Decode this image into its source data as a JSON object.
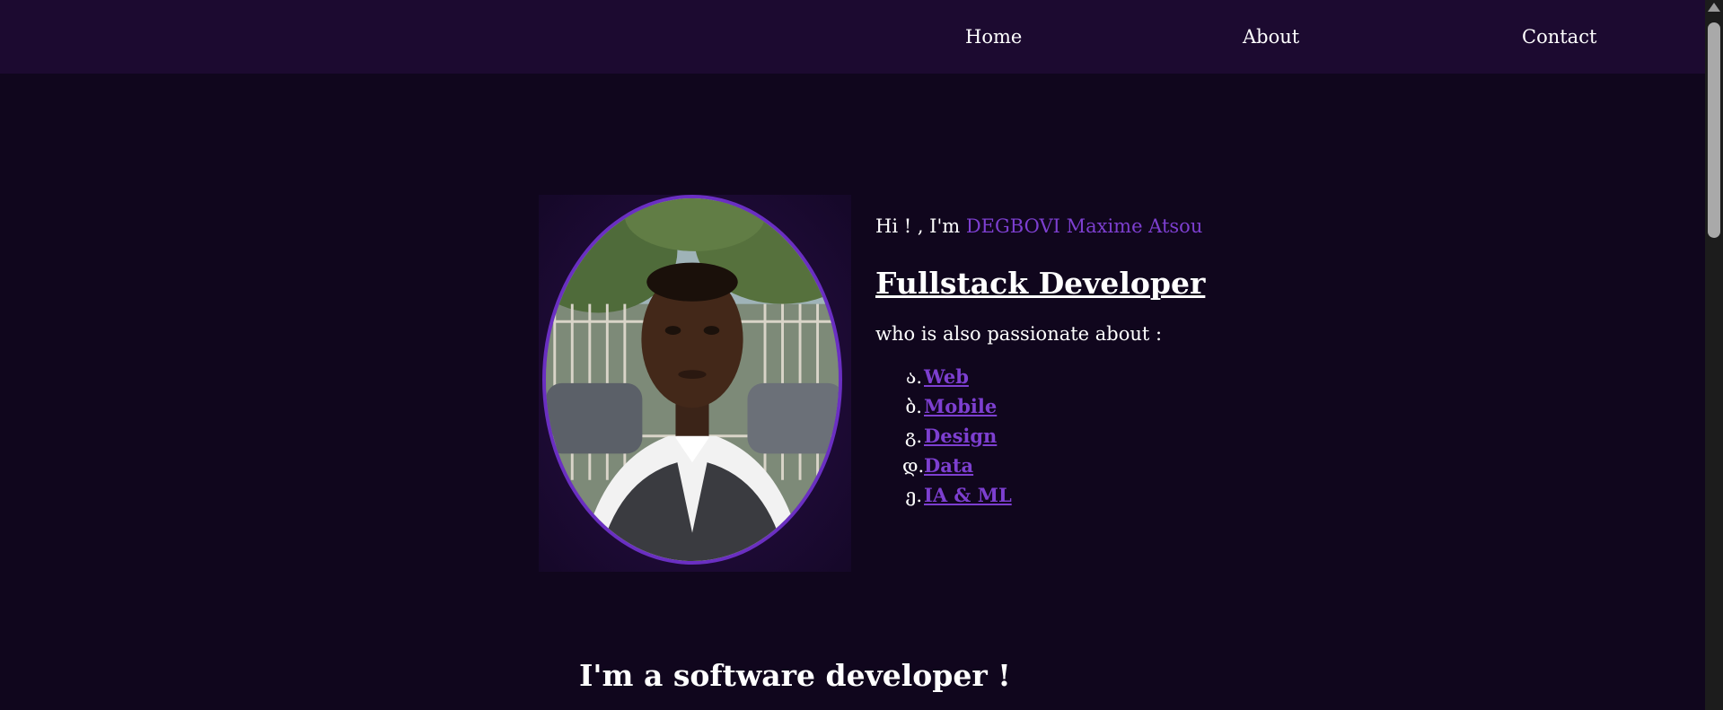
{
  "nav": {
    "home": "Home",
    "about": "About",
    "contact": "Contact"
  },
  "hero": {
    "greeting_prefix": "Hi ! , I'm ",
    "name": "DEGBOVI Maxime Atsou",
    "role": "Fullstack Developer",
    "passion": "who is also passionate about :",
    "skills": [
      {
        "marker": "ა.",
        "label": "Web"
      },
      {
        "marker": "ბ.",
        "label": "Mobile"
      },
      {
        "marker": "გ.",
        "label": "Design"
      },
      {
        "marker": "დ.",
        "label": "Data"
      },
      {
        "marker": "ე.",
        "label": "IA & ML"
      }
    ]
  },
  "section": {
    "subtitle": "I'm a software developer !"
  },
  "colors": {
    "background": "#10061d",
    "navbar": "#1c0a30",
    "accent": "#7d3fd0",
    "frame_border": "#6a2fc2"
  }
}
